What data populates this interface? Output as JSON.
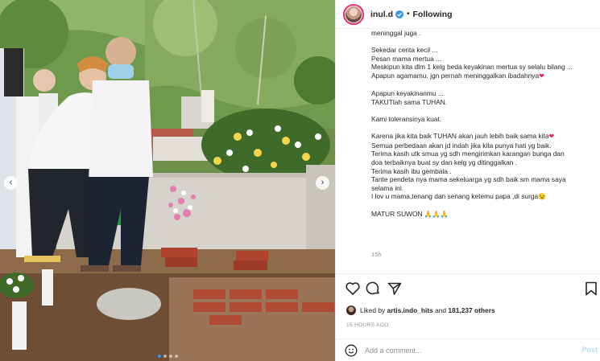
{
  "post": {
    "username": "inul.d",
    "follow_state": "Following",
    "header_separator": "•",
    "caption_lines": [
      "meninggal juga .",
      "",
      "Sekedar cerita kecil ...",
      "Pesan mama mertua ...",
      "Meskipun kita dlm 1 kelg beda keyakinan mertua sy selalu bilang ...",
      "Apapun agamamu, jgn pernah meninggalkan ibadahnya",
      "",
      "Apapun keyakinanmu ...",
      "TAKUTlah sama TUHAN.",
      "",
      "Kami toleransinya kuat.",
      "",
      "Karena jika kita baik TUHAN akan jauh lebih baik sama kita",
      "Semua perbedaan akan jd indah jika kita punya hati yg baik.",
      "Terima kasih utk smua yg sdh mengirimkan karangan bunga dan",
      "doa terbaiknya buat sy dan kelg yg ditinggalkan .",
      "Terima kasih ibu gembala .",
      "Tante pendeta nya mama sekeluarga yg sdh baik sm mama saya",
      "selama ini.",
      "I lov u mama,tenang dan senang ketemu papa ,di surga",
      "",
      "MATUR SUWON"
    ],
    "caption_emojis": {
      "heart": "❤",
      "wink": "😉",
      "pray": "🙏🙏🙏"
    },
    "caption_age": "15h",
    "likes": {
      "prefix": "Liked by",
      "user": "artis.indo_hits",
      "joiner": "and",
      "count": "181,237 others"
    },
    "timestamp": "15 HOURS AGO",
    "comment_placeholder": "Add a comment...",
    "post_button": "Post"
  },
  "carousel": {
    "prev_icon": "‹",
    "next_icon": "›",
    "slides": 4,
    "active_index": 0
  },
  "colors": {
    "verified_blue": "#3897f0",
    "heart_red": "#e0245e",
    "post_button_disabled": "#b2dffc",
    "muted_text": "#8e8e8e"
  },
  "icons": {
    "like": "heart-outline-icon",
    "comment": "comment-bubble-icon",
    "share": "paper-plane-icon",
    "save": "bookmark-icon",
    "emoji": "smiley-icon"
  }
}
